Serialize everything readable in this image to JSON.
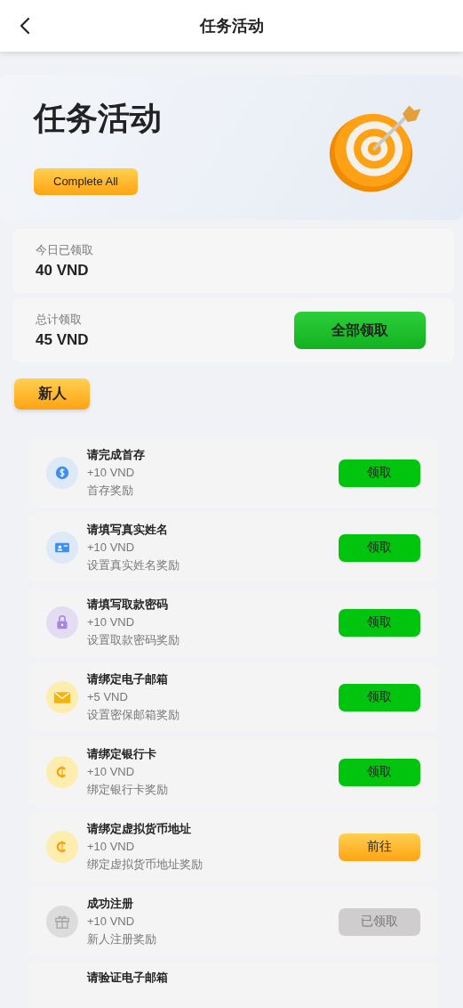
{
  "header": {
    "title": "任务活动"
  },
  "hero": {
    "title": "任务活动",
    "button": "Complete All"
  },
  "stats": [
    {
      "label": "今日已领取",
      "value": "40 VND"
    },
    {
      "label": "总计领取",
      "value": "45 VND",
      "button": "全部领取"
    }
  ],
  "category_tab": {
    "label": "新人"
  },
  "tasks": [
    {
      "kind": "dollar",
      "title": "请完成首存",
      "amount": "+10 VND",
      "description": "首存奖励",
      "action": {
        "kind": "claim",
        "label": "领取"
      }
    },
    {
      "kind": "card",
      "title": "请填写真实姓名",
      "amount": "+10 VND",
      "description": "设置真实姓名奖励",
      "action": {
        "kind": "claim",
        "label": "领取"
      }
    },
    {
      "kind": "lock",
      "title": "请填写取款密码",
      "amount": "+10 VND",
      "description": "设置取款密码奖励",
      "action": {
        "kind": "claim",
        "label": "领取"
      }
    },
    {
      "kind": "mail",
      "title": "请绑定电子邮箱",
      "amount": "+5 VND",
      "description": "设置密保邮箱奖励",
      "action": {
        "kind": "claim",
        "label": "领取"
      }
    },
    {
      "kind": "coin",
      "title": "请绑定银行卡",
      "amount": "+10 VND",
      "description": "绑定银行卡奖励",
      "action": {
        "kind": "claim",
        "label": "领取"
      }
    },
    {
      "kind": "coin",
      "title": "请绑定虚拟货币地址",
      "amount": "+10 VND",
      "description": "绑定虚拟货币地址奖励",
      "action": {
        "kind": "go",
        "label": "前往"
      }
    },
    {
      "kind": "gift",
      "title": "成功注册",
      "amount": "+10 VND",
      "description": "新人注册奖励",
      "action": {
        "kind": "claimed",
        "label": "已领取"
      }
    },
    {
      "title": "请验证电子邮箱"
    }
  ]
}
